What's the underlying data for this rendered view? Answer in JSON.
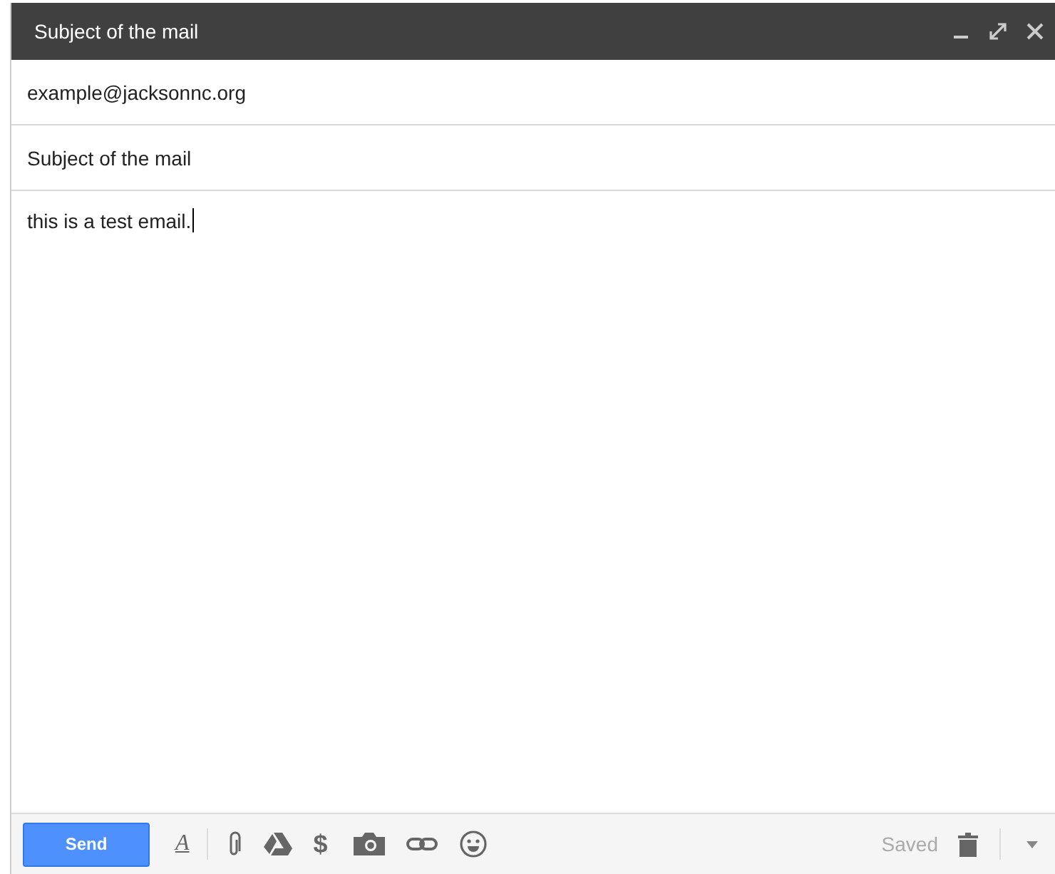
{
  "window": {
    "title": "Subject of the mail"
  },
  "to": {
    "value": "example@jacksonnc.org"
  },
  "subject": {
    "value": "Subject of the mail"
  },
  "body": {
    "text": "this is a test email.",
    "cursor": true
  },
  "toolbar": {
    "send": "Send",
    "format_glyph": "A",
    "money_glyph": "$",
    "status": "Saved"
  }
}
